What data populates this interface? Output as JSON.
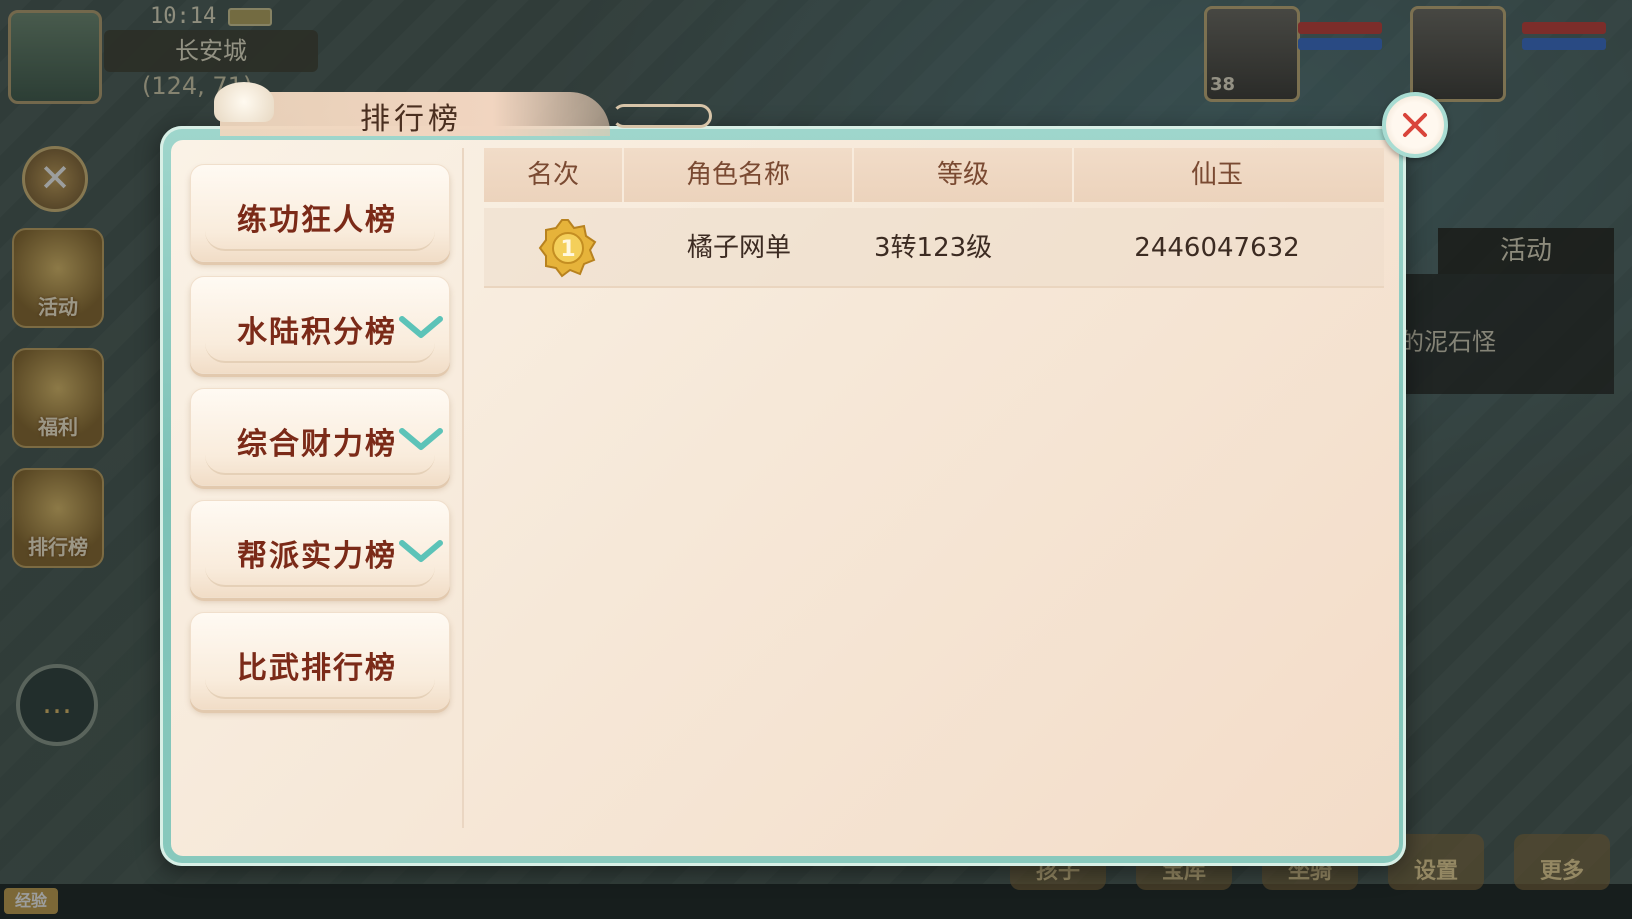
{
  "hud": {
    "clock": "10:14",
    "city_name": "长安城",
    "coords": "(124, 71)"
  },
  "sidebar": {
    "activity_label": "活动",
    "welfare_label": "福利",
    "ranking_label": "排行榜"
  },
  "right_panel": {
    "activity_tab": "活动",
    "quest_text": "的泥石怪",
    "portrait_level": "38"
  },
  "bottom_bar": {
    "exp_label": "经验",
    "buttons": [
      "孩子",
      "宝库",
      "坐骑",
      "设置",
      "更多"
    ]
  },
  "dialog": {
    "title": "排行榜",
    "categories": [
      {
        "label": "练功狂人榜",
        "has_check": false
      },
      {
        "label": "水陆积分榜",
        "has_check": true
      },
      {
        "label": "综合财力榜",
        "has_check": true
      },
      {
        "label": "帮派实力榜",
        "has_check": true
      },
      {
        "label": "比武排行榜",
        "has_check": false
      }
    ],
    "table": {
      "columns": [
        "名次",
        "角色名称",
        "等级",
        "仙玉"
      ],
      "rows": [
        {
          "rank": "1",
          "name": "橘子网单",
          "level": "3转123级",
          "jade": "2446047632"
        }
      ]
    }
  },
  "colors": {
    "frame_teal": "#7cc1b6",
    "category_text": "#7b2a18",
    "check_teal": "#5cc3b8",
    "close_red": "#d9443a",
    "medal_gold": "#e6b33a"
  }
}
